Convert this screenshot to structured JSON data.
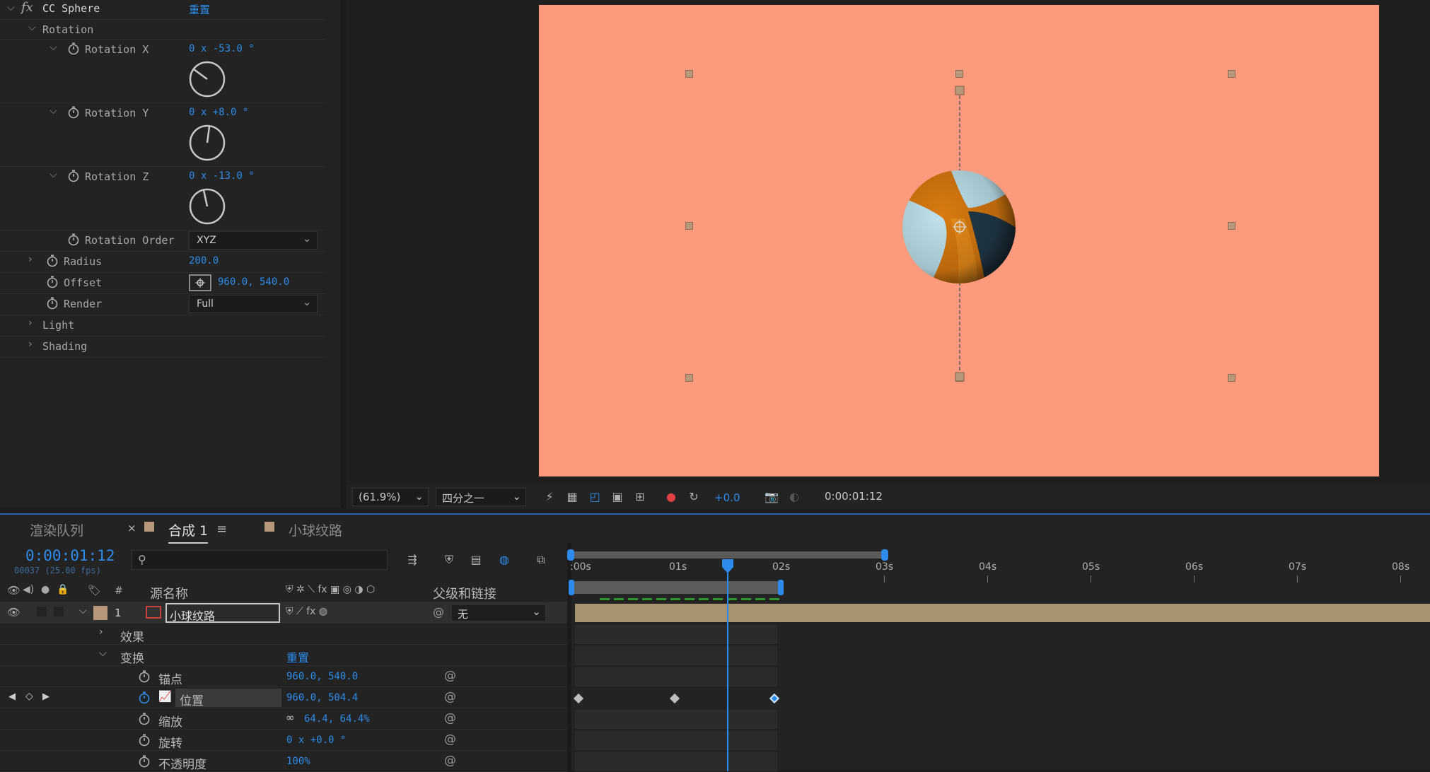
{
  "effects_panel": {
    "effect_name": "CC Sphere",
    "reset_label": "重置",
    "group_rotation": "Rotation",
    "rotation_x": {
      "label": "Rotation X",
      "value": "0 x -53.0 °"
    },
    "rotation_y": {
      "label": "Rotation Y",
      "value": "0 x +8.0 °"
    },
    "rotation_z": {
      "label": "Rotation Z",
      "value": "0 x -13.0 °"
    },
    "rotation_order": {
      "label": "Rotation Order",
      "value": "XYZ"
    },
    "radius": {
      "label": "Radius",
      "value": "200.0"
    },
    "offset": {
      "label": "Offset",
      "value": "960.0, 540.0"
    },
    "render": {
      "label": "Render",
      "value": "Full"
    },
    "light": {
      "label": "Light"
    },
    "shading": {
      "label": "Shading"
    }
  },
  "viewer": {
    "background_color": "#fc9a7d",
    "zoom": "(61.9%)",
    "resolution": "四分之一",
    "exposure": "+0.0",
    "timecode": "0:00:01:12"
  },
  "timeline": {
    "tabs": {
      "render_queue": "渲染队列",
      "comp": "合成 1",
      "layer_comp": "小球纹路"
    },
    "current_time": "0:00:01:12",
    "frame_info": "00037 (25.00 fps)",
    "col_number": "#",
    "col_source_name": "源名称",
    "col_parent": "父级和链接",
    "layer": {
      "index": "1",
      "name": "小球纹路",
      "parent": "无"
    },
    "effects_label": "效果",
    "transform_label": "变换",
    "transform_reset": "重置",
    "anchor": {
      "label": "锚点",
      "value": "960.0, 540.0"
    },
    "position": {
      "label": "位置",
      "value": "960.0, 504.4"
    },
    "scale": {
      "label": "缩放",
      "value": "64.4, 64.4%"
    },
    "rotation": {
      "label": "旋转",
      "value": "0 x +0.0 °"
    },
    "opacity": {
      "label": "不透明度",
      "value": "100%"
    },
    "ruler": [
      ":00s",
      "01s",
      "02s",
      "03s",
      "04s",
      "05s",
      "06s",
      "07s",
      "08s"
    ],
    "accent_color": "#2d8ceb"
  }
}
